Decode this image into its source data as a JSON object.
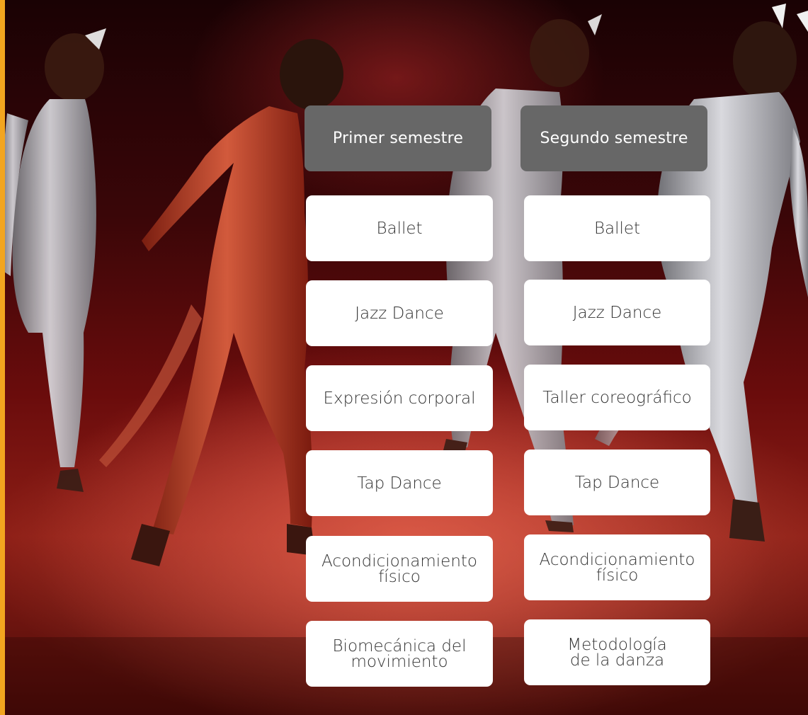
{
  "columns": [
    {
      "header": "Primer semestre",
      "items": [
        "Ballet",
        "Jazz Dance",
        "Expresión corporal",
        "Tap Dance",
        "Acondicionamiento\nfísico",
        "Biomecánica del\nmovimiento"
      ]
    },
    {
      "header": "Segundo semestre",
      "items": [
        "Ballet",
        "Jazz Dance",
        "Taller coreográfico",
        "Tap Dance",
        "Acondicionamiento\nfísico",
        "Metodología\nde la danza"
      ]
    }
  ],
  "colors": {
    "accent_stripe": "#f2a51f",
    "header_bg": "#676767",
    "card_bg": "#ffffff",
    "card_text": "#333333"
  }
}
